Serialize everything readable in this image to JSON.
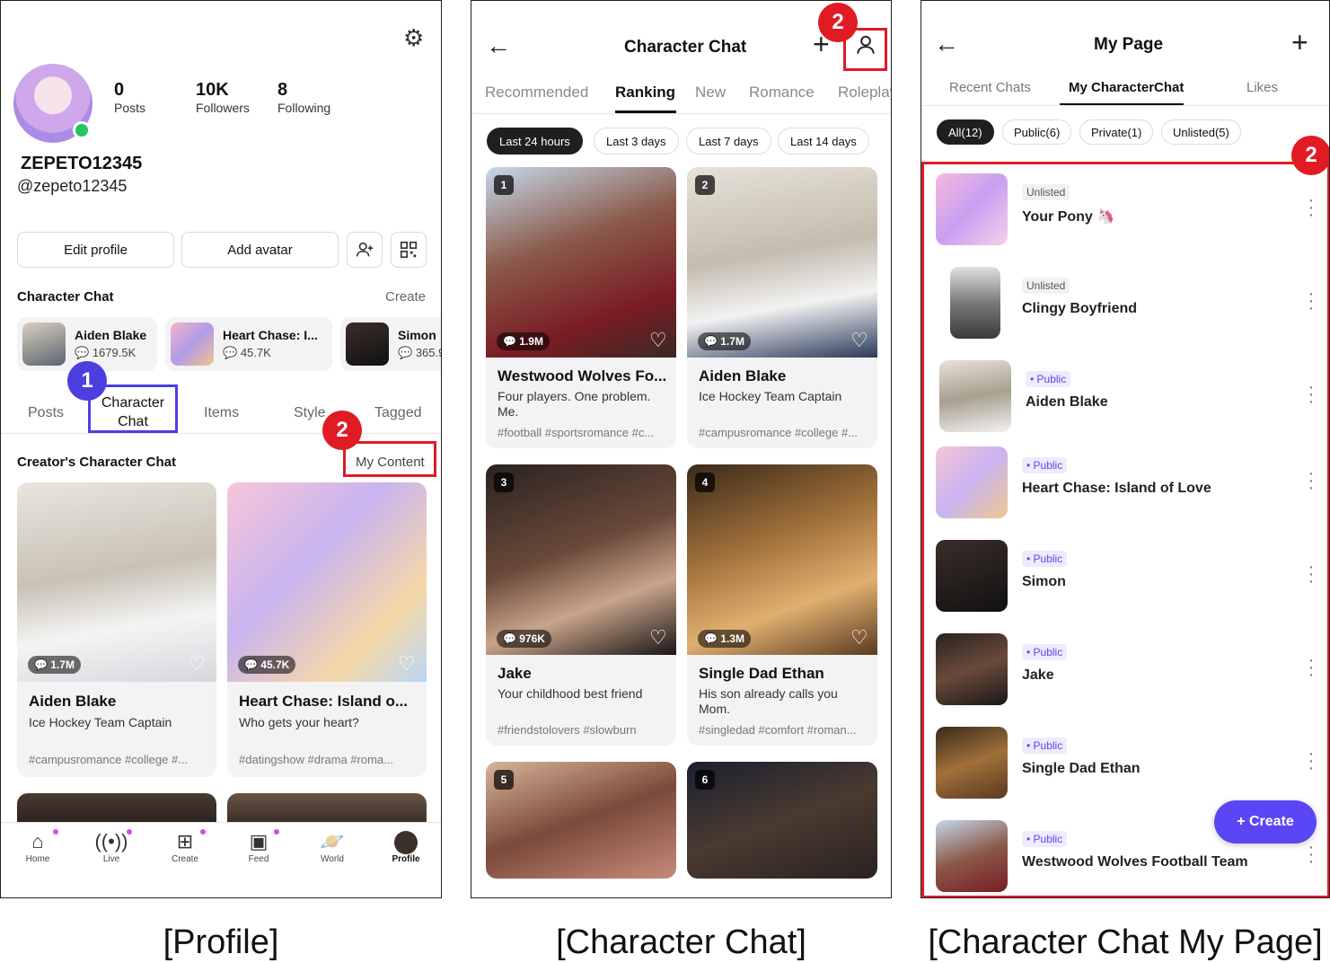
{
  "captions": [
    "[Profile]",
    "[Character Chat]",
    "[Character Chat My Page]"
  ],
  "markers": {
    "one": "1",
    "two": "2"
  },
  "profile": {
    "stats": [
      {
        "value": "0",
        "label": "Posts"
      },
      {
        "value": "10K",
        "label": "Followers"
      },
      {
        "value": "8",
        "label": "Following"
      }
    ],
    "username": "ZEPETO12345",
    "handle": "@zepeto12345",
    "edit_profile": "Edit profile",
    "add_avatar": "Add avatar",
    "section_title": "Character Chat",
    "section_action": "Create",
    "chips": [
      {
        "name": "Aiden Blake",
        "count": "1679.5K"
      },
      {
        "name": "Heart Chase: I...",
        "count": "45.7K"
      },
      {
        "name": "Simon",
        "count": "365.9"
      }
    ],
    "tabs": [
      "Posts",
      "Character Chat",
      "Items",
      "Style",
      "Tagged"
    ],
    "creator_title": "Creator's Character Chat",
    "my_content": "My Content",
    "cards": [
      {
        "count": "1.7M",
        "title": "Aiden Blake",
        "desc": "Ice Hockey Team Captain",
        "tags": "#campusromance #college #..."
      },
      {
        "count": "45.7K",
        "title": "Heart Chase: Island o...",
        "desc": "Who gets your heart?",
        "tags": "#datingshow #drama #roma..."
      }
    ],
    "nav": [
      "Home",
      "Live",
      "Create",
      "Feed",
      "World",
      "Profile"
    ]
  },
  "character_chat": {
    "title": "Character Chat",
    "tabs": [
      "Recommended",
      "Ranking",
      "New",
      "Romance",
      "Roleplay"
    ],
    "time_filters": [
      "Last 24 hours",
      "Last 3 days",
      "Last 7 days",
      "Last 14 days"
    ],
    "cards": [
      {
        "rank": "1",
        "count": "1.9M",
        "title": "Westwood Wolves Fo...",
        "desc": "Four players. One problem. Me.",
        "tags": "#football #sportsromance #c..."
      },
      {
        "rank": "2",
        "count": "1.7M",
        "title": "Aiden Blake",
        "desc": "Ice Hockey Team Captain",
        "tags": "#campusromance #college #..."
      },
      {
        "rank": "3",
        "count": "976K",
        "title": "Jake",
        "desc": "Your childhood best friend",
        "tags": "#friendstolovers #slowburn"
      },
      {
        "rank": "4",
        "count": "1.3M",
        "title": "Single Dad Ethan",
        "desc": "His son already calls you Mom.",
        "tags": "#singledad #comfort #roman..."
      },
      {
        "rank": "5"
      },
      {
        "rank": "6"
      }
    ]
  },
  "my_page": {
    "title": "My Page",
    "tabs": [
      "Recent Chats",
      "My CharacterChat",
      "Likes"
    ],
    "filters": [
      "All(12)",
      "Public(6)",
      "Private(1)",
      "Unlisted(5)"
    ],
    "items": [
      {
        "badge": "Unlisted",
        "name": "Your Pony 🦄"
      },
      {
        "badge": "Unlisted",
        "name": "Clingy Boyfriend"
      },
      {
        "badge": "• Public",
        "name": "Aiden Blake"
      },
      {
        "badge": "• Public",
        "name": "Heart Chase: Island of Love"
      },
      {
        "badge": "• Public",
        "name": "Simon"
      },
      {
        "badge": "• Public",
        "name": "Jake"
      },
      {
        "badge": "• Public",
        "name": "Single Dad Ethan"
      },
      {
        "badge": "• Public",
        "name": "Westwood Wolves Football Team"
      }
    ],
    "create": "+ Create"
  },
  "colors": {
    "accent": "#5b46f5",
    "highlight_red": "#e01b24",
    "highlight_blue": "#4b3fe0",
    "online": "#22c55e"
  }
}
